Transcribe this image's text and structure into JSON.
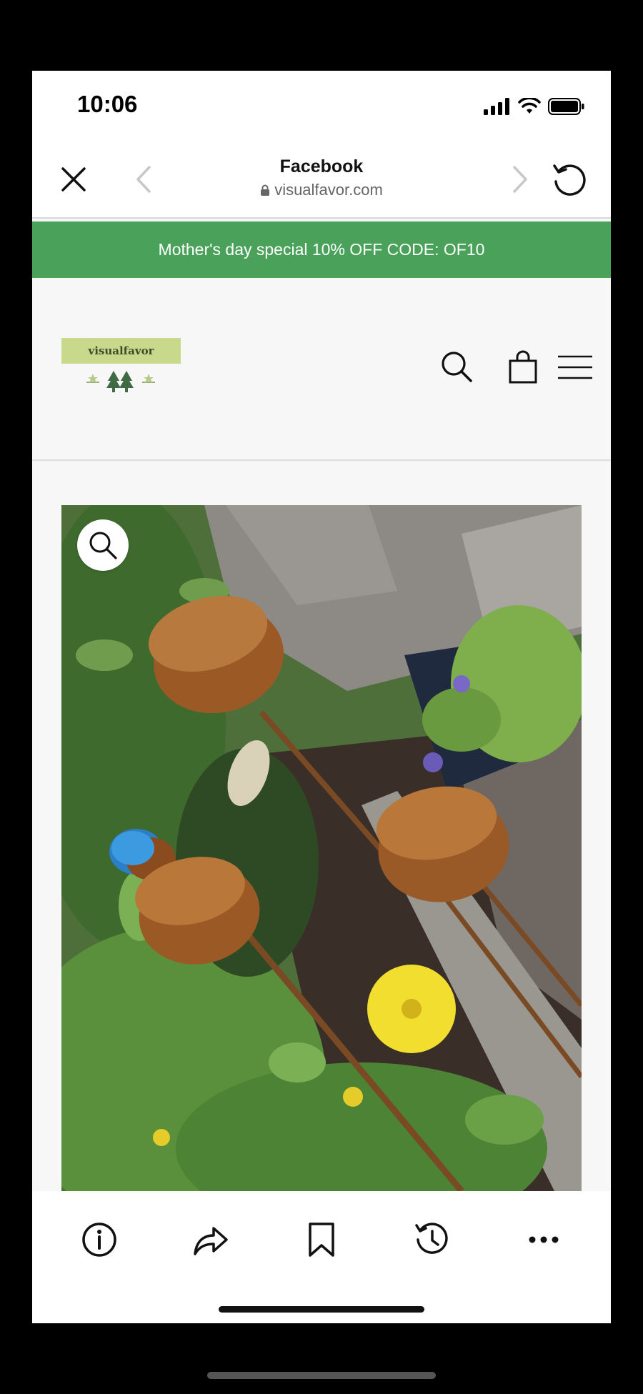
{
  "status_bar": {
    "time": "10:06",
    "icons": [
      "signal-icon",
      "wifi-icon",
      "battery-icon"
    ]
  },
  "browser_nav": {
    "title": "Facebook",
    "url": "visualfavor.com",
    "icons": [
      "close-icon",
      "back-chevron-icon",
      "lock-icon",
      "forward-chevron-icon",
      "reload-icon"
    ]
  },
  "promo_banner": {
    "text": "Mother's day special 10% OFF CODE: OF10",
    "color": "#4aa25a"
  },
  "site_header": {
    "logo_text": "visualfavor",
    "icons": [
      "search-icon",
      "shopping-bag-icon",
      "menu-icon"
    ]
  },
  "product_image": {
    "description_icon": "zoom-icon"
  },
  "browser_toolbar": {
    "icons": [
      "info-icon",
      "share-icon",
      "bookmark-icon",
      "history-icon",
      "more-icon"
    ]
  },
  "colors": {
    "accent_green": "#4aa25a",
    "logo_green": "#c9d98c"
  }
}
